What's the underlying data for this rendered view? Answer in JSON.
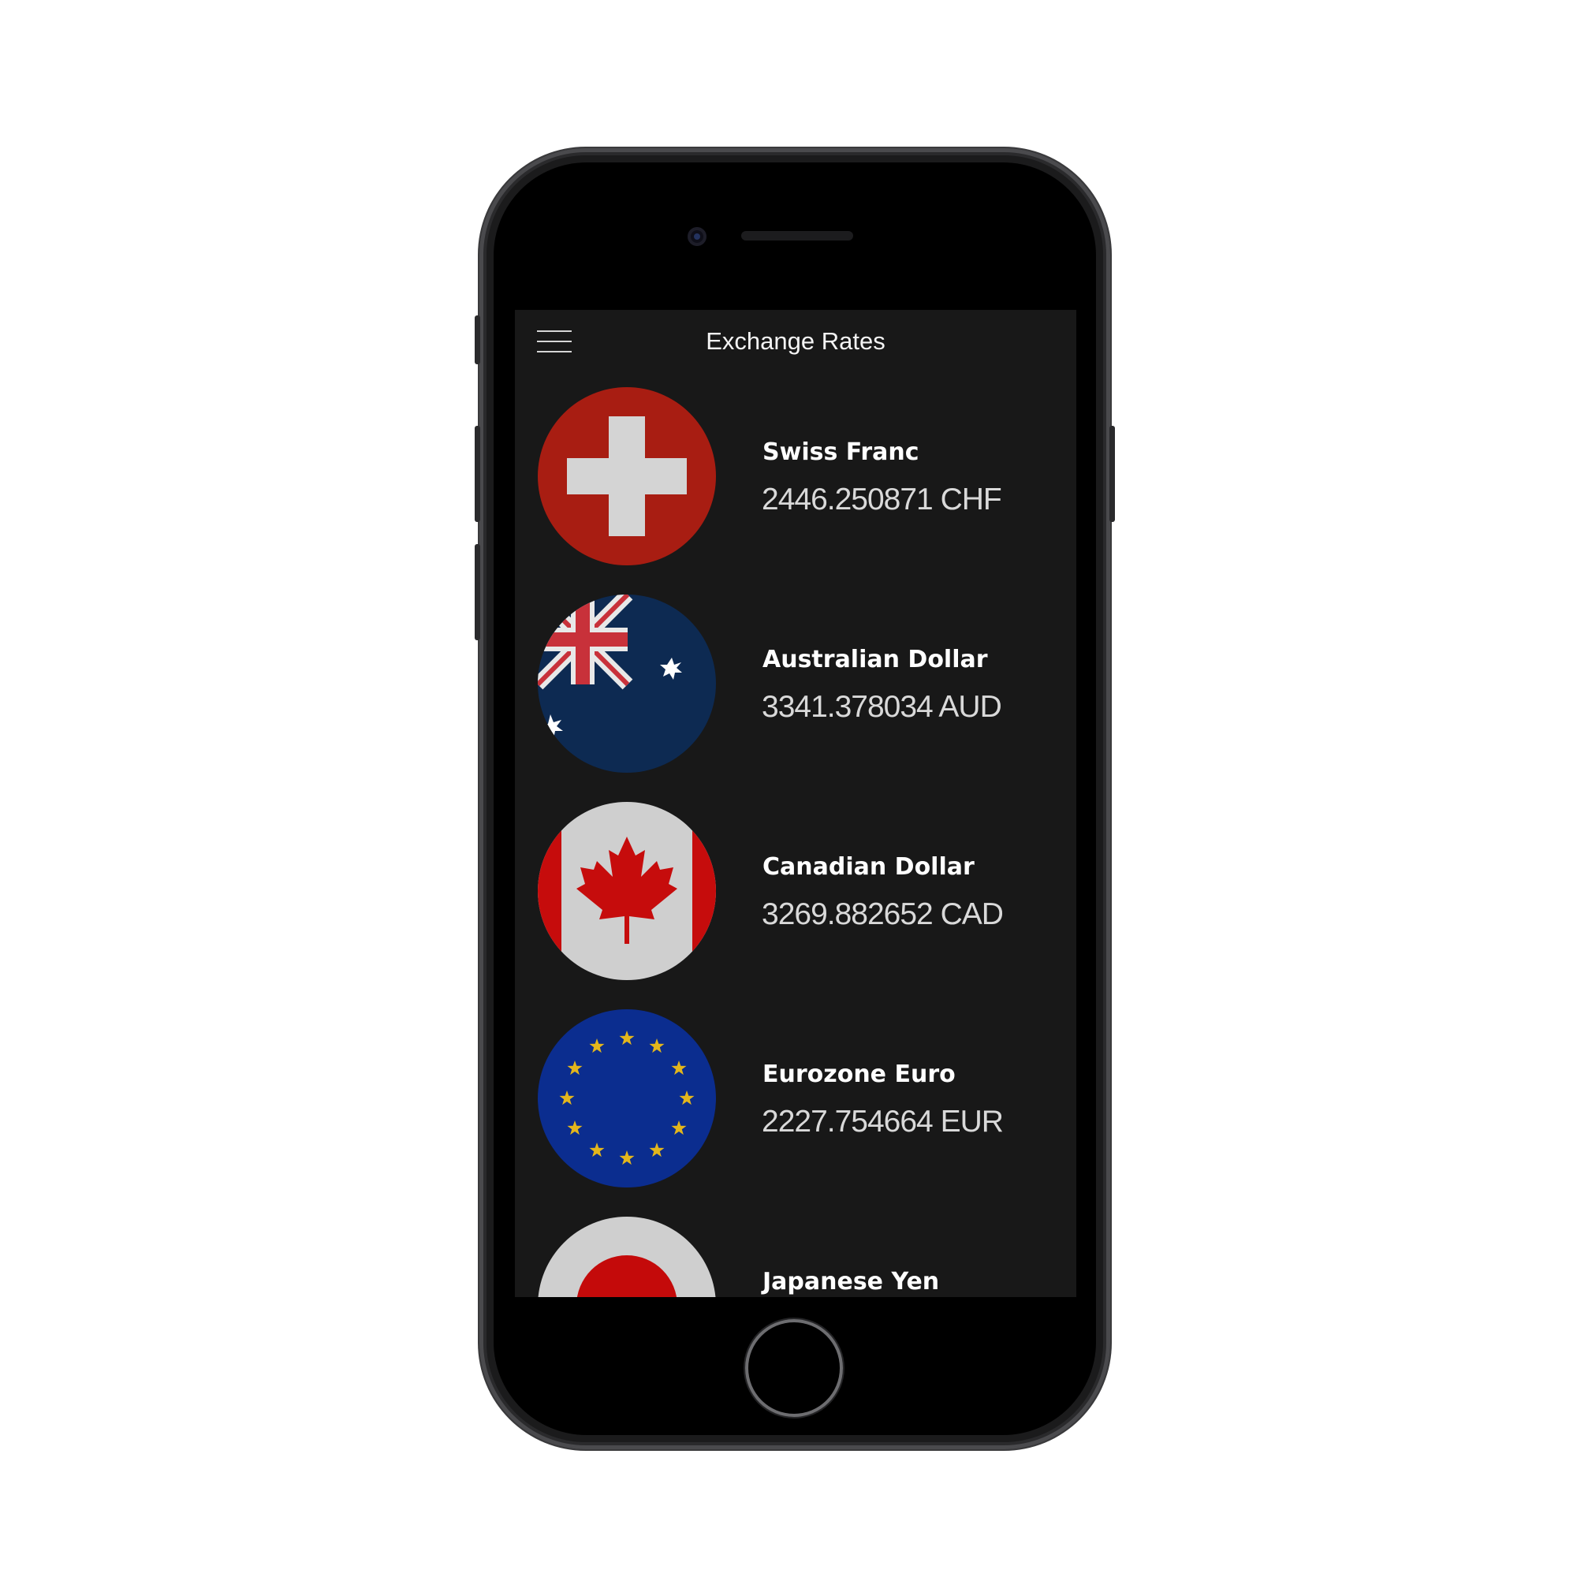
{
  "header": {
    "title": "Exchange Rates",
    "menu_icon": "hamburger-menu-icon"
  },
  "colors": {
    "screen_background": "#181818",
    "swiss_red": "#a81d12",
    "australia_blue": "#0d2a52",
    "canada_red": "#c60c0c",
    "euro_blue": "#0b2d8f",
    "euro_gold": "#e3b61c",
    "japan_red": "#c40a0a",
    "flag_white": "#cfcfcf"
  },
  "currencies": [
    {
      "name": "Swiss Franc",
      "rate": "2446.250871 CHF",
      "flag_icon": "switzerland-flag-icon"
    },
    {
      "name": "Australian Dollar",
      "rate": "3341.378034 AUD",
      "flag_icon": "australia-flag-icon"
    },
    {
      "name": "Canadian Dollar",
      "rate": "3269.882652 CAD",
      "flag_icon": "canada-flag-icon"
    },
    {
      "name": "Eurozone Euro",
      "rate": "2227.754664 EUR",
      "flag_icon": "european-union-flag-icon"
    },
    {
      "name": "Japanese Yen",
      "rate": "",
      "flag_icon": "japan-flag-icon"
    }
  ]
}
